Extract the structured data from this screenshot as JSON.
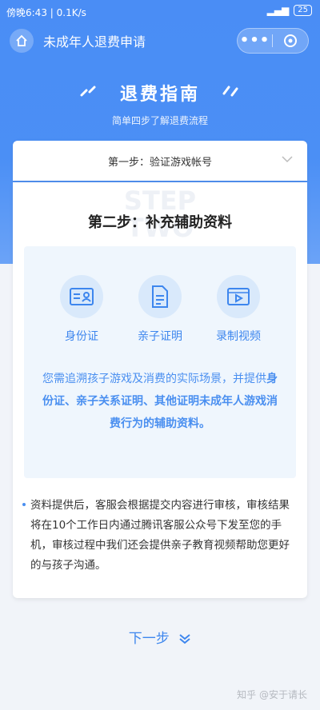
{
  "status_bar": {
    "left": "傍晚6:43 | 0.1K/s",
    "battery": "25"
  },
  "nav": {
    "title": "未成年人退费申请",
    "menu_dots": "•••"
  },
  "hero": {
    "title": "退费指南",
    "subtitle": "简单四步了解退费流程"
  },
  "step1": {
    "label": "第一步：验证游戏帐号"
  },
  "step2": {
    "watermark_line1": "STEP",
    "watermark_line2": "TWO",
    "title": "第二步：补充辅助资料",
    "items": [
      {
        "label": "身份证",
        "icon": "id-card-icon"
      },
      {
        "label": "亲子证明",
        "icon": "document-icon"
      },
      {
        "label": "录制视频",
        "icon": "video-icon"
      }
    ],
    "desc_plain": "您需追溯孩子游戏及消费的实际场景，并提供",
    "desc_bold": "身份证、亲子关系证明、其他证明未成年人游戏消费行为的辅助资料。"
  },
  "note": "资料提供后，客服会根据提交内容进行审核，审核结果将在10个工作日内通过腾讯客服公众号下发至您的手机，审核过程中我们还会提供亲子教育视频帮助您更好的与孩子沟通。",
  "next_label": "下一步",
  "credit": "知乎 @安于请长",
  "colors": {
    "primary": "#4a8df5",
    "accent_text": "#3d86ee"
  }
}
